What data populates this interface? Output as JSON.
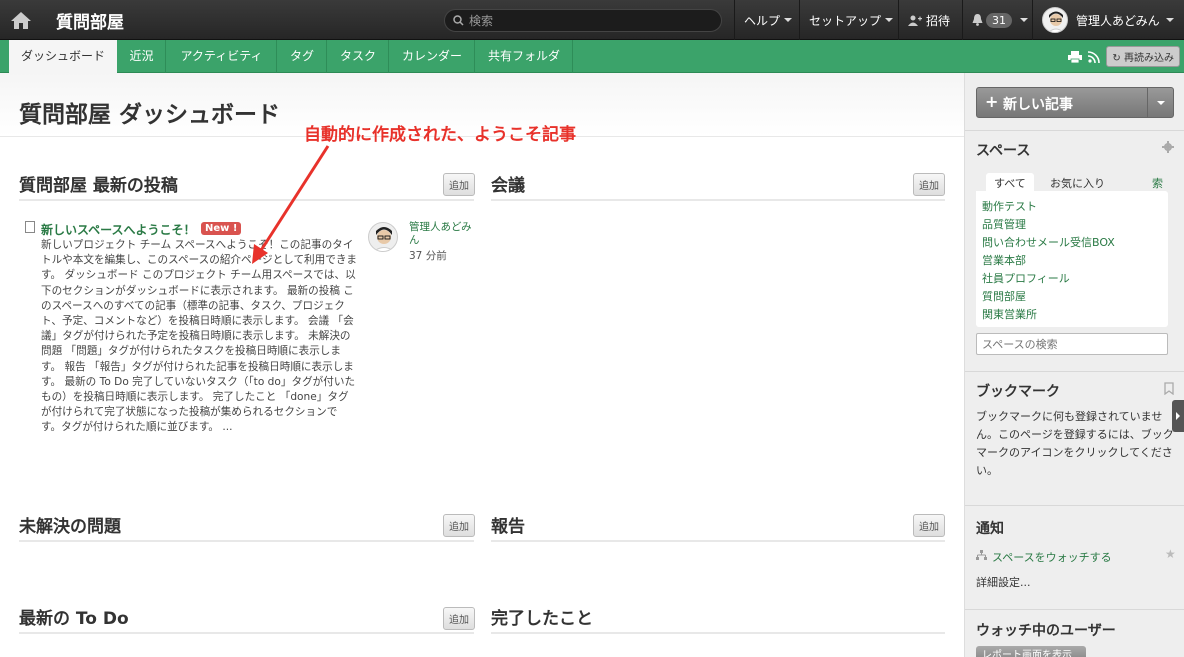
{
  "topbar": {
    "title": "質問部屋",
    "search_placeholder": "検索",
    "help": "ヘルプ",
    "setup": "セットアップ",
    "invite": "招待",
    "notification_count": "31",
    "user": "管理人あどみん"
  },
  "tabs": [
    {
      "label": "ダッシュボード"
    },
    {
      "label": "近況"
    },
    {
      "label": "アクティビティ"
    },
    {
      "label": "タグ"
    },
    {
      "label": "タスク"
    },
    {
      "label": "カレンダー"
    },
    {
      "label": "共有フォルダ"
    }
  ],
  "reload_label": "再読み込み",
  "page_title": "質問部屋 ダッシュボード",
  "annotation": "自動的に作成された、ようこそ記事",
  "add_label": "追加",
  "sections": {
    "latest_posts": "質問部屋 最新の投稿",
    "meetings": "会議",
    "open_issues": "未解決の問題",
    "reports": "報告",
    "latest_todo": "最新の To Do",
    "done": "完了したこと"
  },
  "post": {
    "title": "新しいスペースへようこそ！",
    "badge": "New !",
    "body": "新しいプロジェクト チーム スペースへようこそ！この記事のタイトルや本文を編集し、このスペースの紹介ページとして利用できます。 ダッシュボード このプロジェクト チーム用スペースでは、以下のセクションがダッシュボードに表示されます。 最新の投稿 このスペースへのすべての記事（標準の記事、タスク、プロジェクト、予定、コメントなど）を投稿日時順に表示します。 会議 「会議」タグが付けられた予定を投稿日時順に表示します。 未解決の問題 「問題」タグが付けられたタスクを投稿日時順に表示します。 報告 「報告」タグが付けられた記事を投稿日時順に表示します。 最新の To Do 完了していないタスク（「to do」タグが付いたもの）を投稿日時順に表示します。 完了したこと 「done」タグが付けられて完了状態になった投稿が集められるセクションです。タグが付けられた順に並びます。 ...",
    "author": "管理人あどみん",
    "time": "37 分前"
  },
  "sidebar": {
    "new_post": "新しい記事",
    "spaces_heading": "スペース",
    "tab_all": "すべて",
    "tab_favorites": "お気に入り",
    "index": "索引",
    "spaces": [
      "動作テスト",
      "品質管理",
      "問い合わせメール受信BOX",
      "営業本部",
      "社員プロフィール",
      "質問部屋",
      "関東営業所"
    ],
    "search_placeholder": "スペースの検索",
    "bookmarks_heading": "ブックマーク",
    "bookmarks_text": "ブックマークに何も登録されていません。このページを登録するには、ブックマークのアイコンをクリックしてください。",
    "notify_heading": "通知",
    "watch_space": "スペースをウォッチする",
    "detail_settings": "詳細設定...",
    "watchers_heading": "ウォッチ中のユーザー",
    "report_button": "レポート画面を表示"
  },
  "colors": {
    "accent_green": "#3ba36a",
    "link_green": "#2a7a45",
    "annotation_red": "#e8322b",
    "new_badge": "#d9534f"
  }
}
